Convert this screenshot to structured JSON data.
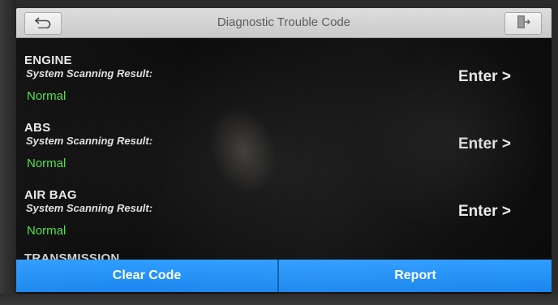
{
  "header": {
    "title": "Diagnostic Trouble Code",
    "back_icon": "back-arrow-icon",
    "exit_icon": "exit-door-icon"
  },
  "systems": [
    {
      "name": "ENGINE",
      "label": "System Scanning Result:",
      "status": "Normal",
      "enter": "Enter >"
    },
    {
      "name": "ABS",
      "label": "System Scanning Result:",
      "status": "Normal",
      "enter": "Enter >"
    },
    {
      "name": "AIR BAG",
      "label": "System Scanning Result:",
      "status": "Normal",
      "enter": "Enter >"
    }
  ],
  "partial_item": {
    "name": "TRANSMISSION"
  },
  "footer": {
    "clear_label": "Clear Code",
    "report_label": "Report"
  },
  "colors": {
    "status_normal": "#4fe04a",
    "button_blue": "#1e8cf5",
    "header_bg": "#d3d3d3"
  }
}
